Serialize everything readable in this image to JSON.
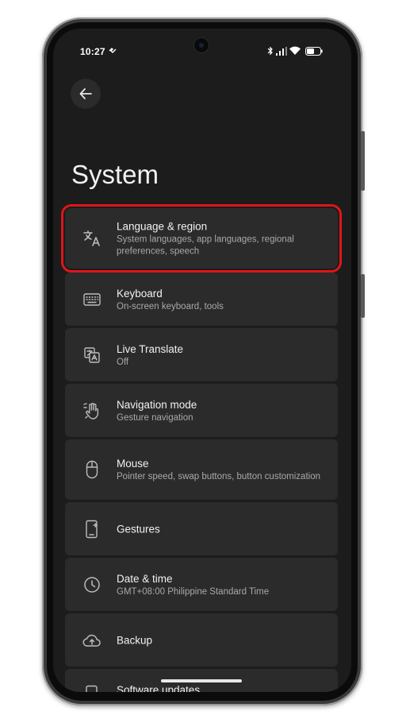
{
  "status_bar": {
    "time": "10:27"
  },
  "header": {
    "title": "System"
  },
  "settings": [
    {
      "title": "Language & region",
      "subtitle": "System languages, app languages, regional preferences, speech",
      "icon": "translate-icon"
    },
    {
      "title": "Keyboard",
      "subtitle": "On-screen keyboard, tools",
      "icon": "keyboard-icon"
    },
    {
      "title": "Live Translate",
      "subtitle": "Off",
      "icon": "live-translate-icon"
    },
    {
      "title": "Navigation mode",
      "subtitle": "Gesture navigation",
      "icon": "gesture-hand-icon"
    },
    {
      "title": "Mouse",
      "subtitle": "Pointer speed, swap buttons, button customization",
      "icon": "mouse-icon"
    },
    {
      "title": "Gestures",
      "subtitle": "",
      "icon": "phone-gesture-icon"
    },
    {
      "title": "Date & time",
      "subtitle": "GMT+08:00 Philippine Standard Time",
      "icon": "clock-icon"
    },
    {
      "title": "Backup",
      "subtitle": "",
      "icon": "cloud-upload-icon"
    },
    {
      "title": "Software updates",
      "subtitle": "",
      "icon": "system-update-icon"
    }
  ],
  "colors": {
    "background": "#1c1c1c",
    "card": "#2b2b2b",
    "highlight": "#e0141a",
    "text_primary": "#f1f1f1",
    "text_secondary": "#a9a9a9"
  }
}
